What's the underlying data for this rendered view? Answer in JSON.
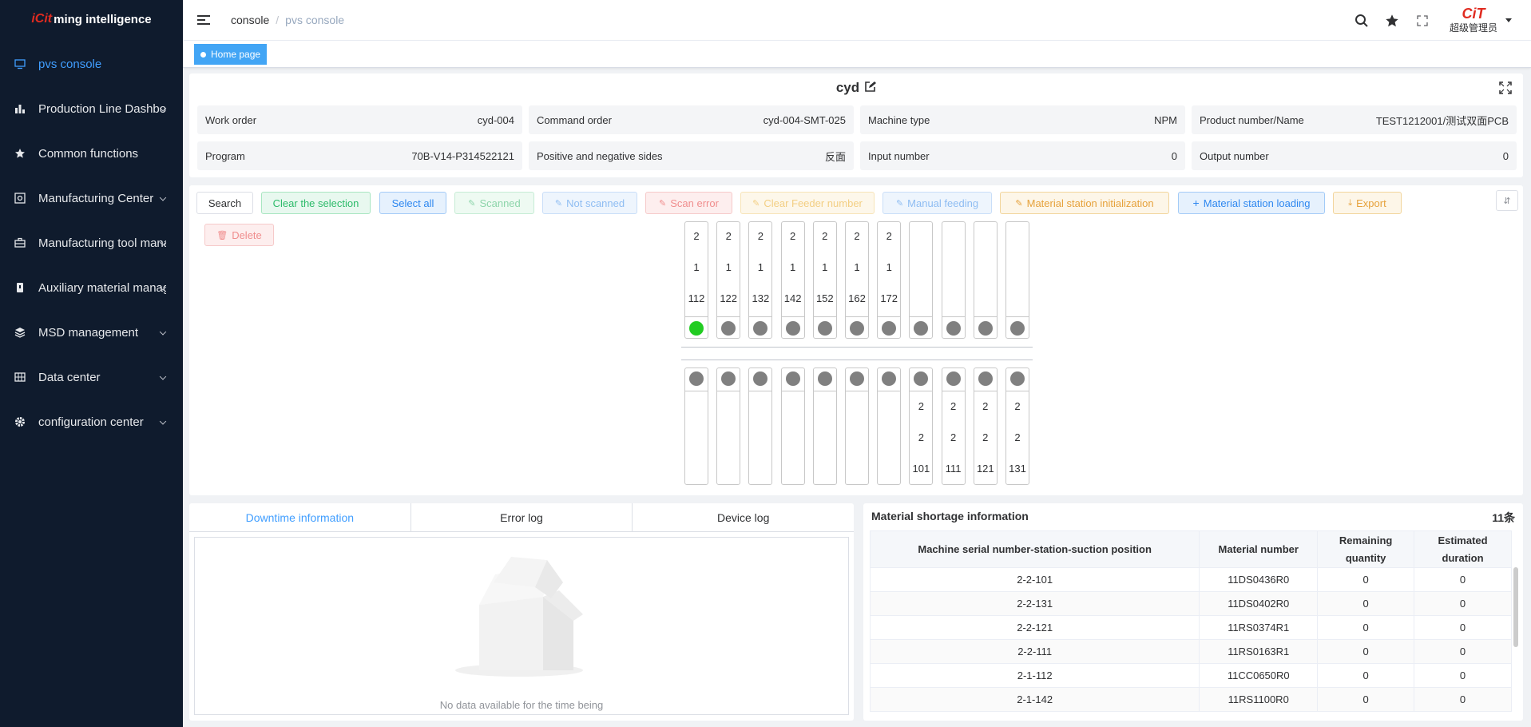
{
  "app": {
    "logo_mark": "iCit",
    "logo_text": "ming intelligence"
  },
  "sidebar": {
    "items": [
      {
        "label": "pvs console",
        "icon": "monitor-icon"
      },
      {
        "label": "Production Line Dashboard",
        "icon": "bar-chart-icon"
      },
      {
        "label": "Common functions",
        "icon": "star-icon"
      },
      {
        "label": "Manufacturing Center",
        "icon": "gear-box-icon"
      },
      {
        "label": "Manufacturing tool management",
        "icon": "toolbox-icon"
      },
      {
        "label": "Auxiliary material management",
        "icon": "bottle-icon"
      },
      {
        "label": "MSD management",
        "icon": "layers-icon"
      },
      {
        "label": "Data center",
        "icon": "grid-icon"
      },
      {
        "label": "configuration center",
        "icon": "gear-icon"
      }
    ]
  },
  "header": {
    "breadcrumb": [
      "console",
      "pvs console"
    ],
    "user_logo": "CiT",
    "user_name": "超级管理员"
  },
  "tags": {
    "home": "Home page"
  },
  "info": {
    "title": "cyd",
    "fields": [
      {
        "label": "Work order",
        "value": "cyd-004"
      },
      {
        "label": "Command order",
        "value": "cyd-004-SMT-025"
      },
      {
        "label": "Machine type",
        "value": "NPM"
      },
      {
        "label": "Product number/Name",
        "value": "TEST1212001/测试双面PCB"
      },
      {
        "label": "Program",
        "value": "70B-V14-P314522121"
      },
      {
        "label": "Positive and negative sides",
        "value": "反面"
      },
      {
        "label": "Input number",
        "value": "0"
      },
      {
        "label": "Output number",
        "value": "0"
      }
    ]
  },
  "toolbar": {
    "search": "Search",
    "clear_selection": "Clear the selection",
    "select_all": "Select all",
    "scanned": "Scanned",
    "not_scanned": "Not scanned",
    "scan_error": "Scan error",
    "clear_feeder": "Clear Feeder number",
    "manual_feeding": "Manual feeding",
    "station_init": "Material station initialization",
    "station_loading": "Material station loading",
    "export": "Export",
    "delete": "Delete"
  },
  "stations": {
    "top": [
      {
        "lines": [
          "2",
          "1",
          "112"
        ],
        "status": "ok"
      },
      {
        "lines": [
          "2",
          "1",
          "122"
        ],
        "status": "idle"
      },
      {
        "lines": [
          "2",
          "1",
          "132"
        ],
        "status": "idle"
      },
      {
        "lines": [
          "2",
          "1",
          "142"
        ],
        "status": "idle"
      },
      {
        "lines": [
          "2",
          "1",
          "152"
        ],
        "status": "idle"
      },
      {
        "lines": [
          "2",
          "1",
          "162"
        ],
        "status": "idle"
      },
      {
        "lines": [
          "2",
          "1",
          "172"
        ],
        "status": "idle"
      },
      {
        "lines": [
          "",
          "",
          ""
        ],
        "status": "idle"
      },
      {
        "lines": [
          "",
          "",
          ""
        ],
        "status": "idle"
      },
      {
        "lines": [
          "",
          "",
          ""
        ],
        "status": "idle"
      },
      {
        "lines": [
          "",
          "",
          ""
        ],
        "status": "idle"
      }
    ],
    "bottom": [
      {
        "lines": [
          "",
          "",
          ""
        ],
        "status": "idle"
      },
      {
        "lines": [
          "",
          "",
          ""
        ],
        "status": "idle"
      },
      {
        "lines": [
          "",
          "",
          ""
        ],
        "status": "idle"
      },
      {
        "lines": [
          "",
          "",
          ""
        ],
        "status": "idle"
      },
      {
        "lines": [
          "",
          "",
          ""
        ],
        "status": "idle"
      },
      {
        "lines": [
          "",
          "",
          ""
        ],
        "status": "idle"
      },
      {
        "lines": [
          "",
          "",
          ""
        ],
        "status": "idle"
      },
      {
        "lines": [
          "2",
          "2",
          "101"
        ],
        "status": "idle"
      },
      {
        "lines": [
          "2",
          "2",
          "111"
        ],
        "status": "idle"
      },
      {
        "lines": [
          "2",
          "2",
          "121"
        ],
        "status": "idle"
      },
      {
        "lines": [
          "2",
          "2",
          "131"
        ],
        "status": "idle"
      }
    ],
    "colors": {
      "ok": "#22cc22",
      "idle": "#808080"
    }
  },
  "log_tabs": {
    "tabs": [
      "Downtime information",
      "Error log",
      "Device log"
    ],
    "empty_text": "No data available for the time being"
  },
  "shortage": {
    "title": "Material shortage information",
    "count": "11条",
    "columns": [
      "Machine serial number-station-suction position",
      "Material number",
      "Remaining quantity",
      "Estimated duration"
    ],
    "rows": [
      [
        "2-2-101",
        "11DS0436R0",
        "0",
        "0"
      ],
      [
        "2-2-131",
        "11DS0402R0",
        "0",
        "0"
      ],
      [
        "2-2-121",
        "11RS0374R1",
        "0",
        "0"
      ],
      [
        "2-2-111",
        "11RS0163R1",
        "0",
        "0"
      ],
      [
        "2-1-112",
        "11CC0650R0",
        "0",
        "0"
      ],
      [
        "2-1-142",
        "11RS1100R0",
        "0",
        "0"
      ]
    ]
  }
}
